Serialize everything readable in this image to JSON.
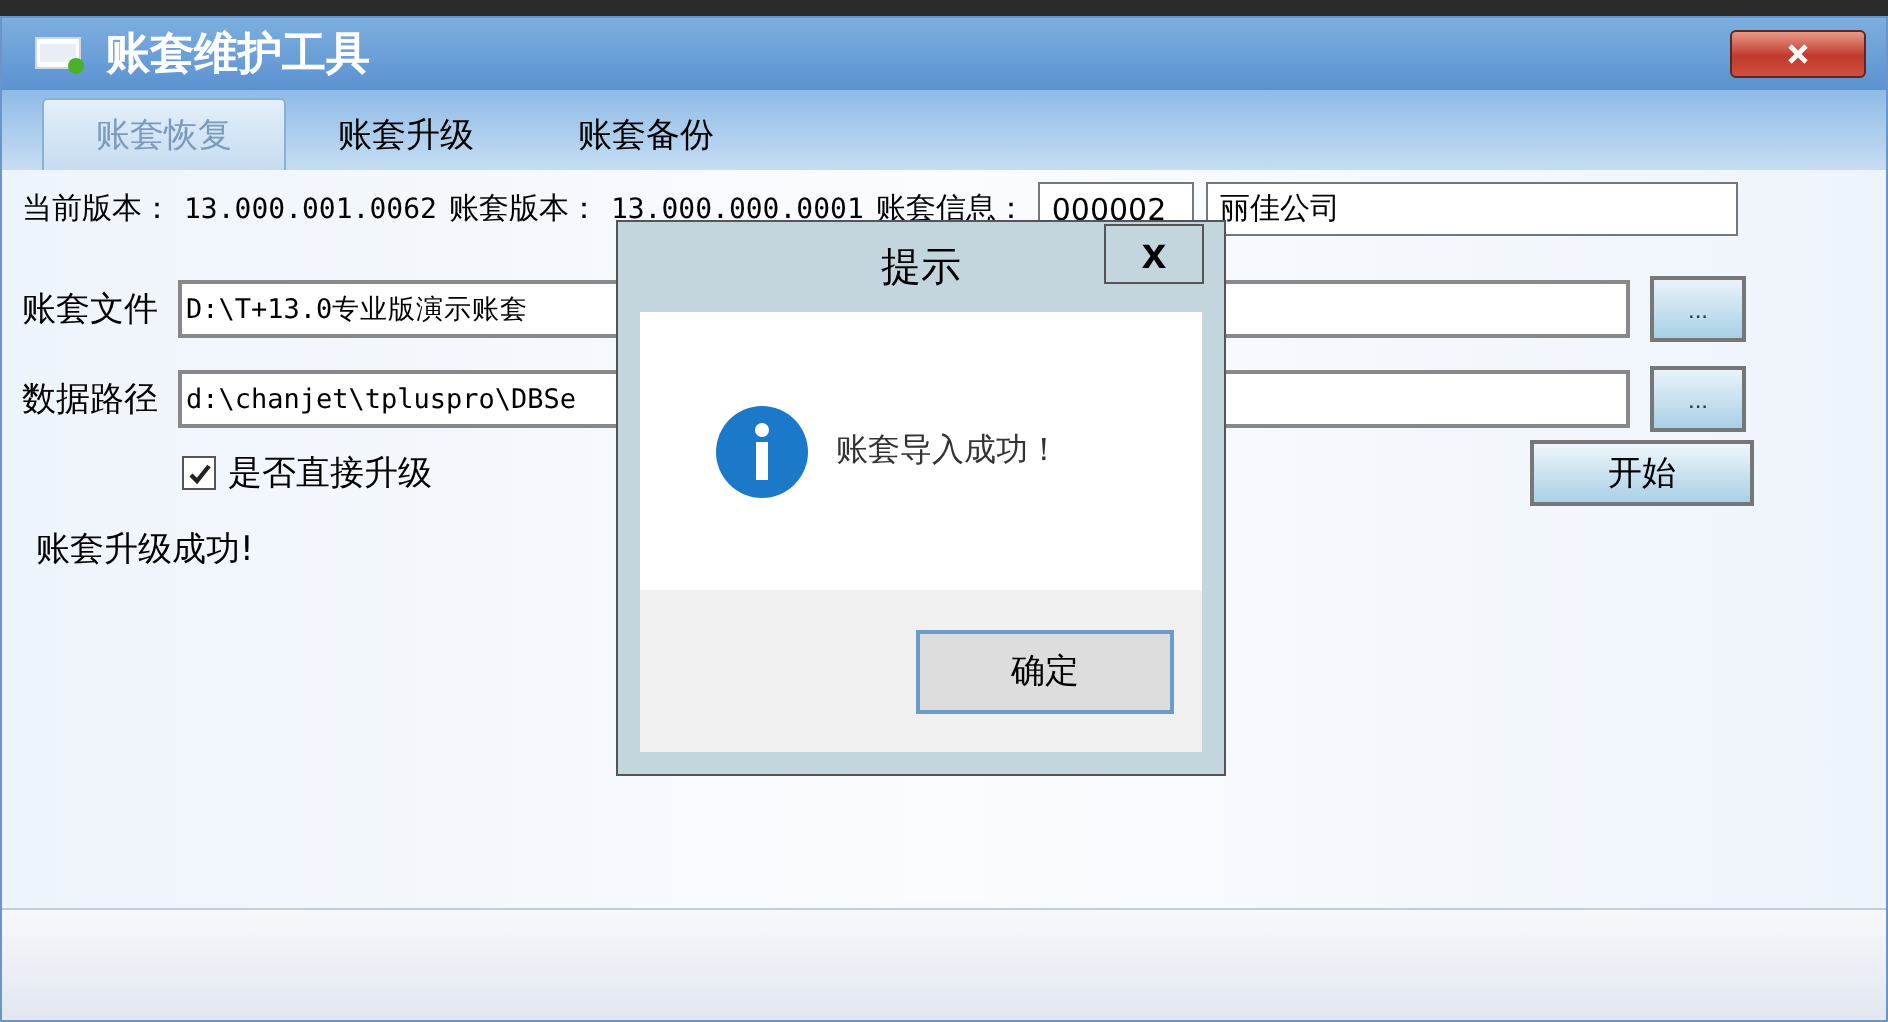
{
  "window": {
    "title": "账套维护工具"
  },
  "tabs": [
    {
      "label": "账套恢复",
      "selected": true
    },
    {
      "label": "账套升级",
      "selected": false
    },
    {
      "label": "账套备份",
      "selected": false
    }
  ],
  "info": {
    "current_version_label": "当前版本：",
    "current_version": "13.000.001.0062",
    "set_version_label": "账套版本：",
    "set_version": "13.000.000.0001",
    "set_info_label": "账套信息：",
    "set_code": "000002",
    "set_name": "丽佳公司"
  },
  "file_row": {
    "label": "账套文件",
    "value": "D:\\T+13.0专业版演示账套",
    "browse": "..."
  },
  "path_row": {
    "label": "数据路径",
    "value": "d:\\chanjet\\tpluspro\\DBSe",
    "browse": "..."
  },
  "direct_upgrade": {
    "label": "是否直接升级",
    "checked": true
  },
  "start_button": "开始",
  "status_text": "账套升级成功!",
  "dialog": {
    "title": "提示",
    "close": "x",
    "message": "账套导入成功！",
    "ok": "确定"
  }
}
